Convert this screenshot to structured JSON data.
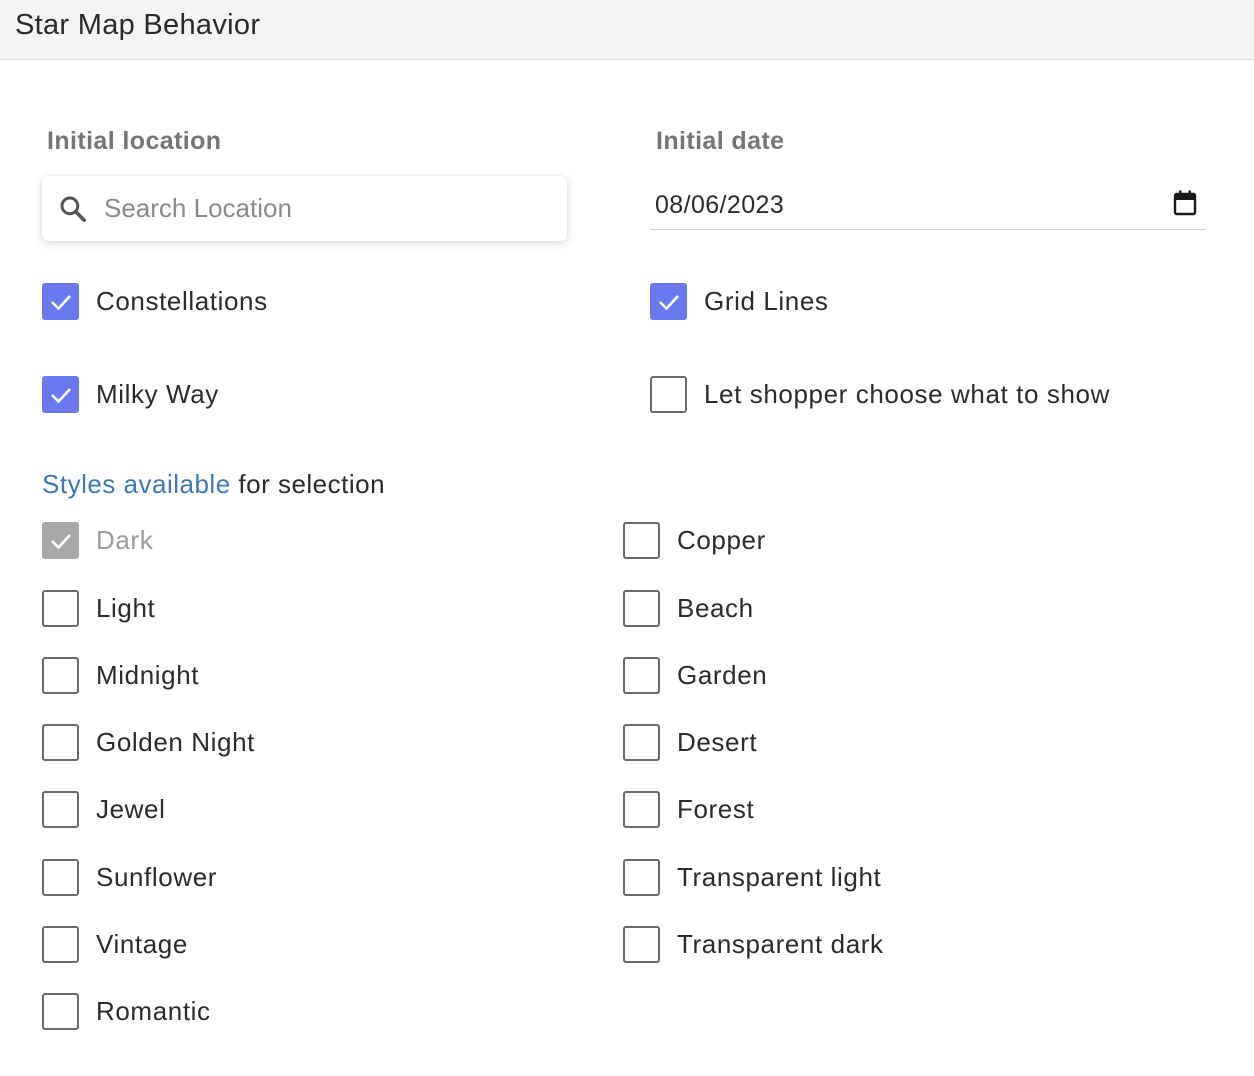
{
  "header": {
    "title": "Star Map Behavior"
  },
  "location": {
    "label": "Initial location",
    "search_placeholder": "Search Location",
    "search_icon": "search-icon"
  },
  "date": {
    "label": "Initial date",
    "value": "08/06/2023",
    "calendar_icon": "calendar-icon"
  },
  "options": {
    "constellations": {
      "label": "Constellations",
      "checked": true
    },
    "grid_lines": {
      "label": "Grid Lines",
      "checked": true
    },
    "milky_way": {
      "label": "Milky Way",
      "checked": true
    },
    "shopper_choose": {
      "label": "Let shopper choose what to show",
      "checked": false
    }
  },
  "styles": {
    "heading_link": "Styles available",
    "heading_rest": " for selection",
    "left": [
      {
        "label": "Dark",
        "checked": true,
        "disabled": true
      },
      {
        "label": "Light",
        "checked": false
      },
      {
        "label": "Midnight",
        "checked": false
      },
      {
        "label": "Golden Night",
        "checked": false
      },
      {
        "label": "Jewel",
        "checked": false
      },
      {
        "label": "Sunflower",
        "checked": false
      },
      {
        "label": "Vintage",
        "checked": false
      },
      {
        "label": "Romantic",
        "checked": false
      }
    ],
    "right": [
      {
        "label": "Copper",
        "checked": false
      },
      {
        "label": "Beach",
        "checked": false
      },
      {
        "label": "Garden",
        "checked": false
      },
      {
        "label": "Desert",
        "checked": false
      },
      {
        "label": "Forest",
        "checked": false
      },
      {
        "label": "Transparent light",
        "checked": false
      },
      {
        "label": "Transparent dark",
        "checked": false
      }
    ]
  },
  "colors": {
    "checked": "#6b78f0",
    "disabled": "#a9a9a9",
    "link": "#3b78b8",
    "section_label": "#757575"
  }
}
